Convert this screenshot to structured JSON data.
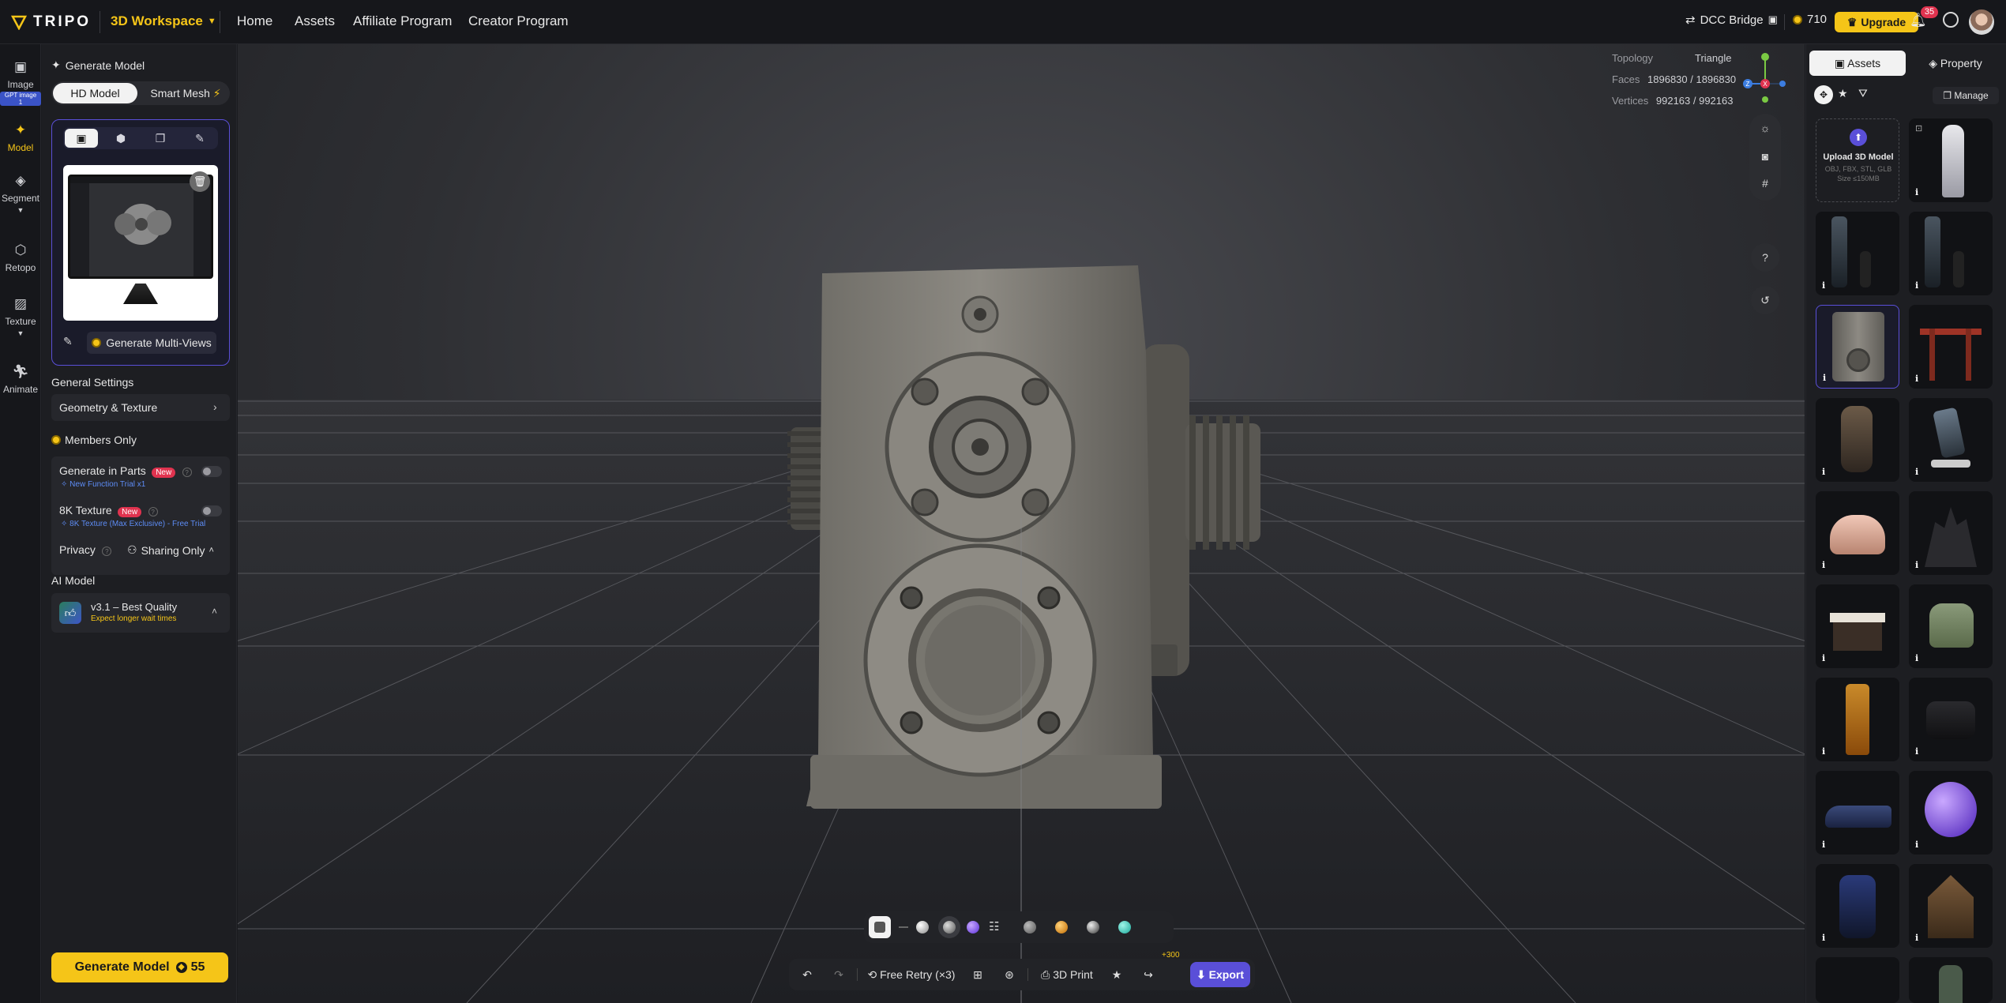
{
  "header": {
    "logo_text": "TRIPO",
    "workspace_label": "3D Workspace",
    "nav": [
      "Home",
      "Assets",
      "Affiliate Program",
      "Creator Program"
    ],
    "dcc_bridge": "DCC Bridge",
    "credits": "710",
    "upgrade": "Upgrade",
    "notifications": "35",
    "brand_color": "#f5c518"
  },
  "rail": {
    "items": [
      {
        "label": "Image",
        "badge": "GPT image 1",
        "icon": "image-icon"
      },
      {
        "label": "Model",
        "icon": "sparkle-icon",
        "active": true
      },
      {
        "label": "Segment",
        "icon": "segment-icon"
      },
      {
        "label": "Retopo",
        "icon": "retopo-icon"
      },
      {
        "label": "Texture",
        "icon": "texture-icon"
      },
      {
        "label": "Animate",
        "icon": "animate-icon"
      }
    ]
  },
  "left": {
    "title": "Generate Model",
    "mode_hd": "HD Model",
    "mode_smart": "Smart Mesh",
    "gen_multiviews": "Generate Multi-Views",
    "general_settings": "General Settings",
    "geo_texture": "Geometry & Texture",
    "members_only": "Members Only",
    "gen_parts": "Generate in Parts",
    "new_tag": "New",
    "gen_parts_sub": "New Function Trial x1",
    "tex8k": "8K Texture",
    "tex8k_sub": "8K Texture (Max Exclusive) - Free Trial",
    "privacy": "Privacy",
    "sharing": "Sharing Only",
    "ai_model": "AI Model",
    "model_name": "v3.1 – Best Quality",
    "model_sub": "Expect longer wait times",
    "gen_button": "Generate Model",
    "gen_cost": "55"
  },
  "viewport": {
    "topology_label": "Topology",
    "topology_value": "Triangle",
    "faces_label": "Faces",
    "faces_value": "1896830 / 1896830",
    "vertices_label": "Vertices",
    "vertices_value": "992163 / 992163",
    "free_retry": "Free Retry (×3)",
    "print": "3D Print",
    "share_bonus": "+300",
    "export": "Export",
    "axis_z": "Z",
    "axis_x": "X"
  },
  "right": {
    "tab_assets": "Assets",
    "tab_property": "Property",
    "manage": "Manage",
    "upload_title": "Upload 3D Model",
    "upload_formats": "OBJ, FBX, STL, GLB",
    "upload_size": "Size ≤150MB",
    "info": "i"
  }
}
